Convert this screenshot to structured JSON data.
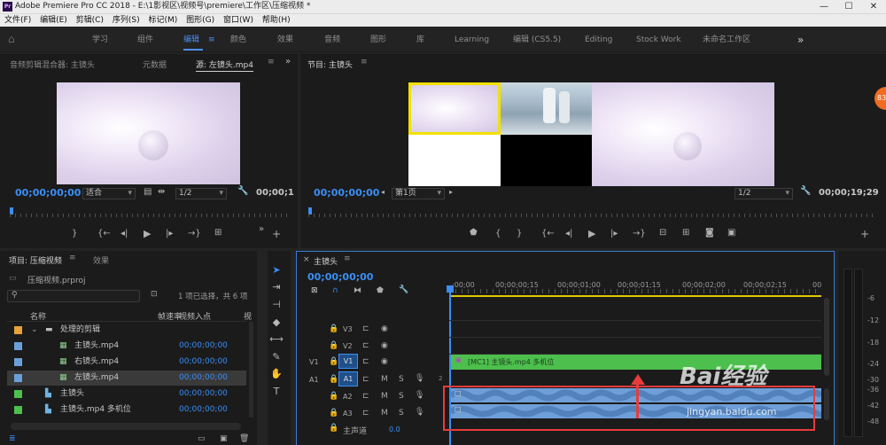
{
  "app": {
    "title": "Adobe Premiere Pro CC 2018 - E:\\1影视区\\视频号\\premiere\\工作区\\压缩视频 *",
    "logo": "Pr",
    "window_controls": [
      "—",
      "☐",
      "✕"
    ]
  },
  "menu": [
    "文件(F)",
    "编辑(E)",
    "剪辑(C)",
    "序列(S)",
    "标记(M)",
    "图形(G)",
    "窗口(W)",
    "帮助(H)"
  ],
  "workspaces": [
    "学习",
    "组件",
    "编辑",
    "颜色",
    "效果",
    "音频",
    "图形",
    "库",
    "Learning",
    "编辑 (CS5.5)",
    "Editing",
    "Stock Work",
    "未命名工作区"
  ],
  "workspace_active": "编辑",
  "workspace_more": "»",
  "source_panel": {
    "tabs": [
      "音频剪辑混合器: 主镜头",
      "元数据",
      "源: 左镜头.mp4"
    ],
    "active_tab": "源: 左镜头.mp4",
    "timecode": "00;00;00;00",
    "fit": "适合",
    "resolution": "1/2",
    "end_timecode": "00;00;1",
    "more": "»"
  },
  "program_panel": {
    "title": "节目: 主镜头",
    "timecode": "00;00;00;00",
    "page": "第1页",
    "resolution": "1/2",
    "end_timecode": "00;00;19;29"
  },
  "project_panel": {
    "tabs": [
      "项目: 压缩视频",
      "效果"
    ],
    "file": "压缩视频.prproj",
    "selection_info": "1 项已选择，共 6 项",
    "columns": [
      "名称",
      "帧速率",
      "视频入点",
      "视"
    ],
    "items": [
      {
        "name": "处理的剪辑",
        "type": "folder",
        "color": "#e8a23a",
        "tc": ""
      },
      {
        "name": "主镜头.mp4",
        "type": "clip",
        "color": "#6aa0d8",
        "tc": "00;00;00;00"
      },
      {
        "name": "右镜头.mp4",
        "type": "clip",
        "color": "#6aa0d8",
        "tc": "00;00;00;00"
      },
      {
        "name": "左镜头.mp4",
        "type": "clip",
        "color": "#6aa0d8",
        "tc": "00;00;00;00"
      },
      {
        "name": "主镜头",
        "type": "sequence",
        "color": "#4cbf4c",
        "tc": "00;00;00;00"
      },
      {
        "name": "主镜头.mp4 多机位",
        "type": "sequence",
        "color": "#4cbf4c",
        "tc": "00;00;00;00"
      }
    ]
  },
  "timeline": {
    "tab": "主镜头",
    "timecode": "00;00;00;00",
    "ruler": [
      ";00;00",
      "00;00;00;15",
      "00;00;01;00",
      "00;00;01;15",
      "00;00;02;00",
      "00;00;02;15",
      "00"
    ],
    "tracks": [
      "V3",
      "V2",
      "V1",
      "A1",
      "A2",
      "A3"
    ],
    "v1_src": "V1",
    "a1_src": "A1",
    "clip_label": "[MC1] 主镜头.mp4 多机位",
    "master_label": "主声道",
    "master_value": "0.0",
    "ch": "2"
  },
  "meter_scale": [
    "-6",
    "-12",
    "-18",
    "-24",
    "-30",
    "-36",
    "-42",
    "-48"
  ],
  "watermark": {
    "brand": "Bai经验",
    "url": "jingyan.baidu.com"
  },
  "badge": "83",
  "colors": {
    "accent": "#3a8ef5",
    "video_clip": "#4cbf4c",
    "audio_clip": "#6f9fd8",
    "annotation": "#e83c3c",
    "selected": "#f2e100"
  }
}
